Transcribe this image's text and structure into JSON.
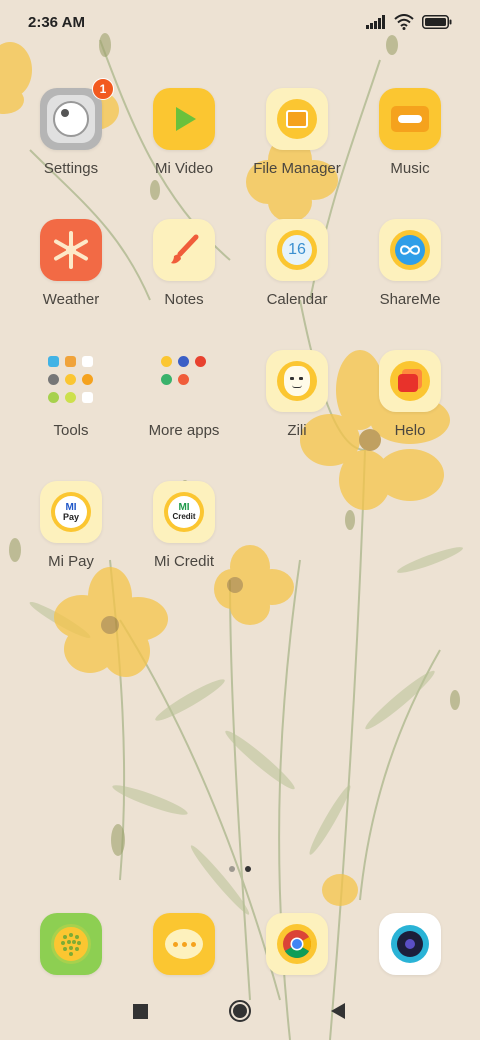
{
  "status": {
    "time": "2:36 AM",
    "signal_icon": "signal-icon",
    "wifi_icon": "wifi-icon",
    "battery_icon": "battery-icon"
  },
  "apps": [
    {
      "label": "Settings",
      "icon": "settings-icon",
      "badge": "1"
    },
    {
      "label": "Mi Video",
      "icon": "play-icon"
    },
    {
      "label": "File Manager",
      "icon": "folder-icon"
    },
    {
      "label": "Music",
      "icon": "cassette-icon"
    },
    {
      "label": "Weather",
      "icon": "snowflake-icon"
    },
    {
      "label": "Notes",
      "icon": "brush-icon"
    },
    {
      "label": "Calendar",
      "icon": "calendar-icon",
      "date": "16"
    },
    {
      "label": "ShareMe",
      "icon": "shareme-icon"
    },
    {
      "label": "Tools",
      "icon": "tools-folder-icon"
    },
    {
      "label": "More apps",
      "icon": "more-apps-folder-icon"
    },
    {
      "label": "Zili",
      "icon": "zili-icon"
    },
    {
      "label": "Helo",
      "icon": "helo-icon"
    },
    {
      "label": "Mi Pay",
      "icon": "mi-pay-icon",
      "logo_top": "MI",
      "logo_bottom": "Pay"
    },
    {
      "label": "Mi Credit",
      "icon": "mi-credit-icon",
      "logo_top": "MI",
      "logo_bottom": "Credit"
    }
  ],
  "dock": [
    {
      "icon": "phone-icon"
    },
    {
      "icon": "messaging-icon"
    },
    {
      "icon": "chrome-icon"
    },
    {
      "icon": "camera-icon"
    }
  ],
  "page_indicator": {
    "pages": 2,
    "current": 2
  },
  "navigation": {
    "recents_icon": "recents-square-icon",
    "home_icon": "home-circle-icon",
    "back_icon": "back-triangle-icon"
  },
  "colors": {
    "background": "#ede2d3",
    "icon_yellow": "#fbc631",
    "icon_pale": "#fdf1bd",
    "badge": "#f25a1f",
    "weather": "#f26a45",
    "dock_phone": "#8dcf52"
  }
}
